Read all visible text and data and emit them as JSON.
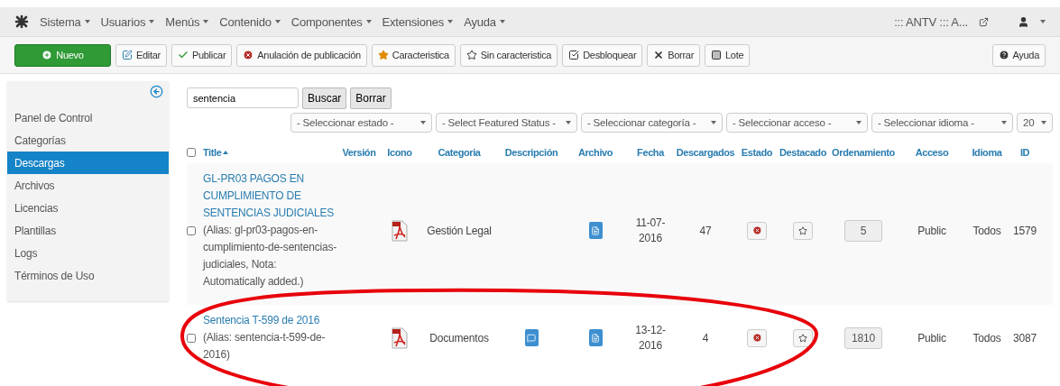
{
  "menubar": {
    "items": [
      "Sistema",
      "Usuarios",
      "Menús",
      "Contenido",
      "Componentes",
      "Extensiones",
      "Ayuda"
    ],
    "site": "::: ANTV ::: A..."
  },
  "toolbar": {
    "buttons": [
      {
        "label": "Nuevo",
        "kind": "new"
      },
      {
        "label": "Editar",
        "kind": "edit"
      },
      {
        "label": "Publicar",
        "kind": "publish"
      },
      {
        "label": "Anulación de publicación",
        "kind": "unpublish"
      },
      {
        "label": "Caracteristica",
        "kind": "feature"
      },
      {
        "label": "Sin caracteristica",
        "kind": "unfeature"
      },
      {
        "label": "Desbloquear",
        "kind": "checkin"
      },
      {
        "label": "Borrar",
        "kind": "delete"
      },
      {
        "label": "Lote",
        "kind": "batch"
      }
    ],
    "help": "Ayuda"
  },
  "sidebar": {
    "items": [
      {
        "label": "Panel de Control",
        "selected": false
      },
      {
        "label": "Categorías",
        "selected": false
      },
      {
        "label": "Descargas",
        "selected": true
      },
      {
        "label": "Archivos",
        "selected": false
      },
      {
        "label": "Licencias",
        "selected": false
      },
      {
        "label": "Plantillas",
        "selected": false
      },
      {
        "label": "Logs",
        "selected": false
      },
      {
        "label": "Términos de Uso",
        "selected": false
      }
    ]
  },
  "search": {
    "value": "sentencia",
    "buttons": [
      "Buscar",
      "Borrar"
    ]
  },
  "filters": [
    "- Seleccionar estado -",
    "- Select Featured Status -",
    "- Seleccionar categoría -",
    "- Seleccionar acceso -",
    "- Seleccionar idioma -",
    "20"
  ],
  "table": {
    "columns": [
      {
        "label": "Title",
        "sorted": true
      },
      {
        "label": "Versión",
        "sorted": false
      },
      {
        "label": "Icono",
        "sorted": false
      },
      {
        "label": "Categoria",
        "sorted": false
      },
      {
        "label": "Descripción",
        "sorted": false
      },
      {
        "label": "Archivo",
        "sorted": false
      },
      {
        "label": "Fecha",
        "sorted": false
      },
      {
        "label": "Descargados",
        "sorted": false
      },
      {
        "label": "Estado",
        "sorted": false
      },
      {
        "label": "Destacado",
        "sorted": false
      },
      {
        "label": "Ordenamiento",
        "sorted": false
      },
      {
        "label": "Acceso",
        "sorted": false
      },
      {
        "label": "Idioma",
        "sorted": false
      },
      {
        "label": "ID",
        "sorted": false
      }
    ],
    "select_all_checked": false,
    "rows": [
      {
        "checked": false,
        "title": "GL-PR03 PAGOS EN CUMPLIMIENTO DE SENTENCIAS JUDICIALES",
        "alias": "(Alias: gl-pr03-pagos-en-cumplimiento-de-sentencias-judiciales, Nota: Automatically added.)",
        "kind": "pdf",
        "category": "Gestión Legal",
        "has_description": false,
        "date": "11-07-2016",
        "downloads": "47",
        "published": false,
        "featured": false,
        "ordering": "5",
        "access": "Public",
        "language": "Todos",
        "id": "1579"
      },
      {
        "checked": false,
        "title": "Sentencia T-599 de 2016",
        "alias": "(Alias: sentencia-t-599-de-2016)",
        "kind": "pdf",
        "category": "Documentos",
        "has_description": true,
        "date": "13-12-2016",
        "downloads": "4",
        "published": false,
        "featured": false,
        "ordering": "1810",
        "access": "Public",
        "language": "Todos",
        "id": "3087"
      }
    ]
  },
  "annotation": {
    "kind": "ellipse"
  }
}
